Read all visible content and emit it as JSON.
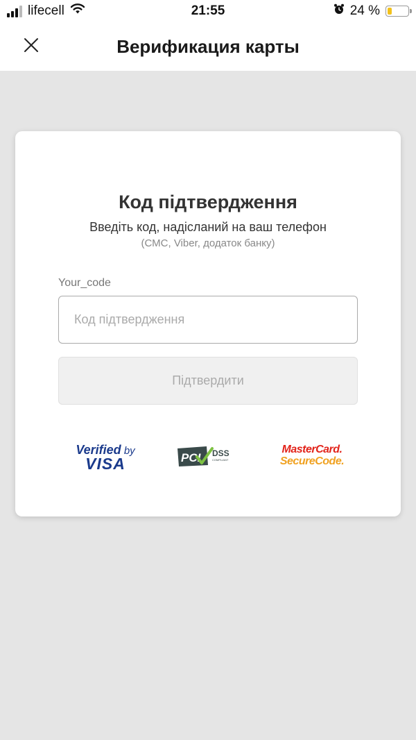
{
  "status_bar": {
    "carrier": "lifecell",
    "time": "21:55",
    "battery_percent_text": "24 %",
    "battery_level": 0.24,
    "signal_bars_active": 3,
    "signal_bars_total": 4,
    "icons": [
      "signal-icon",
      "wifi-icon",
      "alarm-icon",
      "battery-icon"
    ]
  },
  "header": {
    "title": "Верификация карты",
    "close_icon": "close-icon"
  },
  "card": {
    "title": "Код підтвердження",
    "subtitle": "Введіть код, надісланий на ваш телефон",
    "hint": "(СМС, Viber, додаток банку)",
    "field_label": "Your_code",
    "input": {
      "value": "",
      "placeholder": "Код підтвердження"
    },
    "confirm_button_label": "Підтвердити"
  },
  "logos": {
    "visa": {
      "line1": "Verified",
      "line1_suffix": "by",
      "line2": "VISA"
    },
    "pci": {
      "main": "PCI",
      "side": "DSS",
      "small": "COMPLIANT"
    },
    "mastercard": {
      "line1": "MasterCard.",
      "line2": "SecureCode."
    }
  },
  "colors": {
    "page_background": "#e5e5e5",
    "card_background": "#ffffff",
    "battery_fill": "#f2c11b",
    "visa_blue": "#1a3a8c",
    "mastercard_red": "#e2231a",
    "mastercard_orange": "#f0a120",
    "pci_green": "#7dc242",
    "pci_dark": "#3a4a4a"
  }
}
